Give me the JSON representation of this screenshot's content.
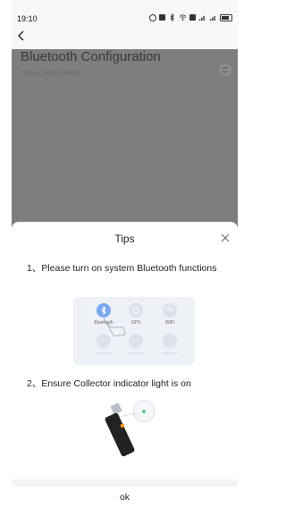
{
  "status_bar": {
    "time": "19:10",
    "icons": [
      "eye-icon",
      "box-icon",
      "bluetooth-icon",
      "wifi-icon",
      "hd-icon",
      "signal-icon",
      "signal-icon",
      "battery-icon"
    ]
  },
  "nav": {
    "back_icon": "chevron-left-icon"
  },
  "page": {
    "title": "Bluetooth Configuration",
    "subtitle": "Please Select Device",
    "refresh_icon": "refresh-icon"
  },
  "sheet": {
    "title": "Tips",
    "close_icon": "close-icon",
    "tip1": "1、Please turn on system Bluetooth functions",
    "tip2": "2、Ensure Collector indicator light is on",
    "controls": [
      {
        "label": "Bluetooth",
        "icon": "bluetooth-icon",
        "active": true
      },
      {
        "label": "GPS",
        "icon": "gps-icon",
        "active": false
      },
      {
        "label": "WIFI",
        "icon": "wifi-icon",
        "active": false
      }
    ],
    "ok_label": "ok"
  },
  "colors": {
    "overlay": "#7e7e7e",
    "accent": "#7aa8ee",
    "sheet_bg": "#ffffff",
    "illus_bg": "#eef1f6"
  }
}
